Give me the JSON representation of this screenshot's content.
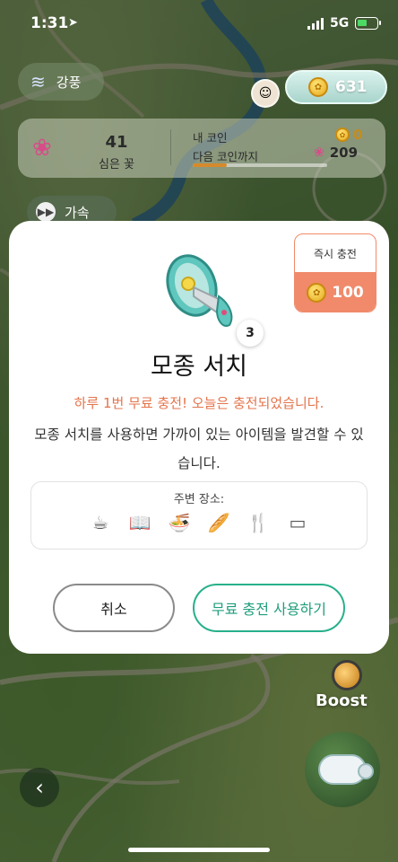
{
  "status_bar": {
    "time": "1:31",
    "network": "5G"
  },
  "hud": {
    "wind": {
      "icon": "wind-icon",
      "label": "강풍"
    },
    "coins": {
      "icon": "coin-icon",
      "value": "631"
    },
    "planted": {
      "count": "41",
      "label": "심은 꽃"
    },
    "my_coin": {
      "label": "내 코인",
      "value": "0"
    },
    "next_coin": {
      "label": "다음 코인까지",
      "value": "209",
      "progress": 0.25
    },
    "speed": {
      "label": "가속"
    }
  },
  "modal": {
    "instant_charge": {
      "label": "즉시 충전",
      "price": "100"
    },
    "item_icon": "megaphone-icon",
    "count": "3",
    "title": "모종 서치",
    "free_note": "하루 1번 무료 충전! 오늘은 충전되었습니다.",
    "description": "모종 서치를 사용하면 가까이 있는 아이템을  발견할 수 있습니다.",
    "nearby_label": "주변 장소:",
    "nearby_icons": [
      "coffee-icon",
      "book-icon",
      "noodle-bowl-icon",
      "bread-icon",
      "utensils-icon",
      "bench-icon"
    ],
    "cancel_label": "취소",
    "use_label": "무료 충전 사용하기"
  },
  "boost_label": "Boost",
  "colors": {
    "accent_green": "#27b08a",
    "accent_orange": "#f08a6a",
    "note_orange": "#e4744c"
  }
}
